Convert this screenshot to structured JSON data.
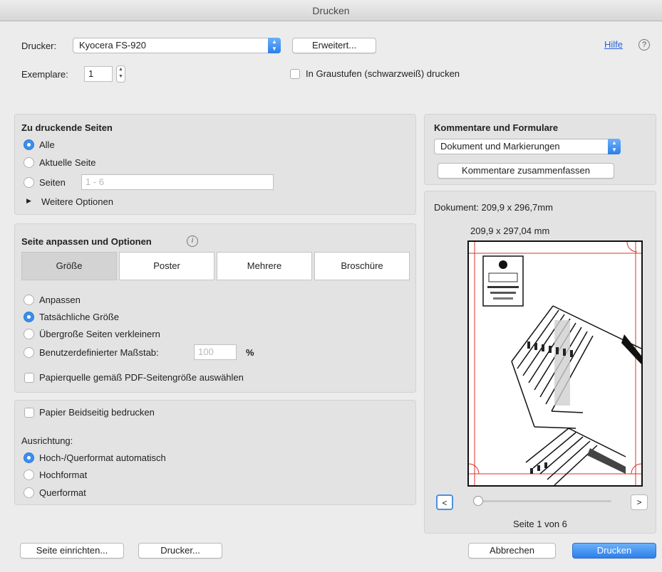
{
  "window": {
    "title": "Drucken"
  },
  "top": {
    "printer_label": "Drucker:",
    "printer_value": "Kyocera FS-920",
    "advanced_button": "Erweitert...",
    "help_link": "Hilfe",
    "help_icon_glyph": "?",
    "copies_label": "Exemplare:",
    "copies_value": "1",
    "grayscale_label": "In Graustufen (schwarzweiß) drucken"
  },
  "pages_panel": {
    "title": "Zu druckende Seiten",
    "options": [
      "Alle",
      "Aktuelle Seite",
      "Seiten"
    ],
    "selected_index": 0,
    "range_placeholder": "1 - 6",
    "more_options": "Weitere Optionen"
  },
  "fit_panel": {
    "title": "Seite anpassen und Optionen",
    "info_glyph": "i",
    "tabs": [
      "Größe",
      "Poster",
      "Mehrere",
      "Broschüre"
    ],
    "active_tab_index": 0,
    "options": [
      "Anpassen",
      "Tatsächliche Größe",
      "Übergroße Seiten verkleinern",
      "Benutzerdefinierter Maßstab:"
    ],
    "selected_index": 1,
    "scale_value": "100",
    "scale_unit": "%",
    "paper_source_label": "Papierquelle gemäß PDF-Seitengröße auswählen"
  },
  "duplex_panel": {
    "duplex_label": "Papier Beidseitig bedrucken",
    "orientation_label": "Ausrichtung:",
    "options": [
      "Hoch-/Querformat automatisch",
      "Hochformat",
      "Querformat"
    ],
    "selected_index": 0
  },
  "comments_panel": {
    "title": "Kommentare und Formulare",
    "select_value": "Dokument und Markierungen",
    "summarize_button": "Kommentare zusammenfassen"
  },
  "preview": {
    "document_size": "Dokument: 209,9 x 296,7mm",
    "page_size": "209,9 x 297,04 mm",
    "prev_label": "<",
    "next_label": ">",
    "page_indicator": "Seite 1 von 6",
    "slider_position": 0,
    "page_index": 1,
    "page_count": 6
  },
  "bottom": {
    "page_setup_button": "Seite einrichten...",
    "printer_button": "Drucker...",
    "cancel_button": "Abbrechen",
    "print_button": "Drucken"
  },
  "colors": {
    "accent": "#3a8ef0",
    "panel_bg": "#e3e3e3",
    "window_bg": "#ececec",
    "margin_line": "#e0302a"
  },
  "icons": {
    "stepper": "stepper-icon",
    "dropdown": "dropdown-arrow-icon",
    "disclosure": "disclosure-triangle-icon",
    "help": "help-icon",
    "info": "info-icon"
  }
}
